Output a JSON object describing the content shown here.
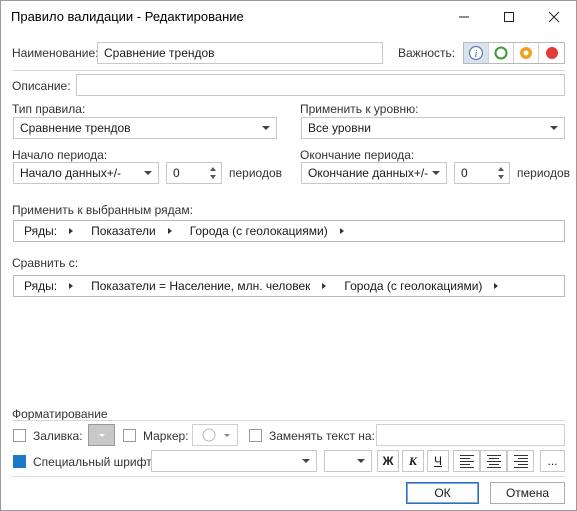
{
  "window": {
    "title": "Правило валидации - Редактирование",
    "minimize": "—",
    "maximize": "☐",
    "close": "✕"
  },
  "name": {
    "label": "Наименование:",
    "value": "Сравнение трендов"
  },
  "severity": {
    "label": "Важность:",
    "options": [
      {
        "icon": "info-icon",
        "color": "#5a7fa8",
        "active": true
      },
      {
        "icon": "green-circle-icon",
        "color": "#3a9a3a"
      },
      {
        "icon": "orange-circle-icon",
        "color": "#f0a020"
      },
      {
        "icon": "red-circle-icon",
        "color": "#e03c3c"
      }
    ]
  },
  "description": {
    "label": "Описание:",
    "value": ""
  },
  "rule_type": {
    "label": "Тип правила:",
    "value": "Сравнение трендов"
  },
  "apply_level": {
    "label": "Применить к уровню:",
    "value": "Все уровни"
  },
  "period_start": {
    "label": "Начало периода:",
    "value": "Начало данных+/-",
    "count": "0",
    "unit": "периодов"
  },
  "period_end": {
    "label": "Окончание периода:",
    "value": "Окончание данных+/-",
    "count": "0",
    "unit": "периодов"
  },
  "apply_rows": {
    "label": "Применить к выбранным рядам:",
    "segments": [
      "Ряды:",
      "Показатели",
      "Города (с геолокациями)"
    ]
  },
  "compare": {
    "label": "Сравнить с:",
    "segments": [
      "Ряды:",
      "Показатели = Население, млн. человек",
      "Города (с геолокациями)"
    ]
  },
  "formatting": {
    "label": "Форматирование",
    "fill_label": "Заливка:",
    "marker_label": "Маркер:",
    "replace_label": "Заменять текст на:",
    "replace_value": "",
    "special_font_label": "Специальный шрифт:",
    "font_value": "",
    "size_value": "",
    "bold": "Ж",
    "italic": "К",
    "underline": "Ч",
    "more": "..."
  },
  "buttons": {
    "ok": "ОК",
    "cancel": "Отмена"
  }
}
